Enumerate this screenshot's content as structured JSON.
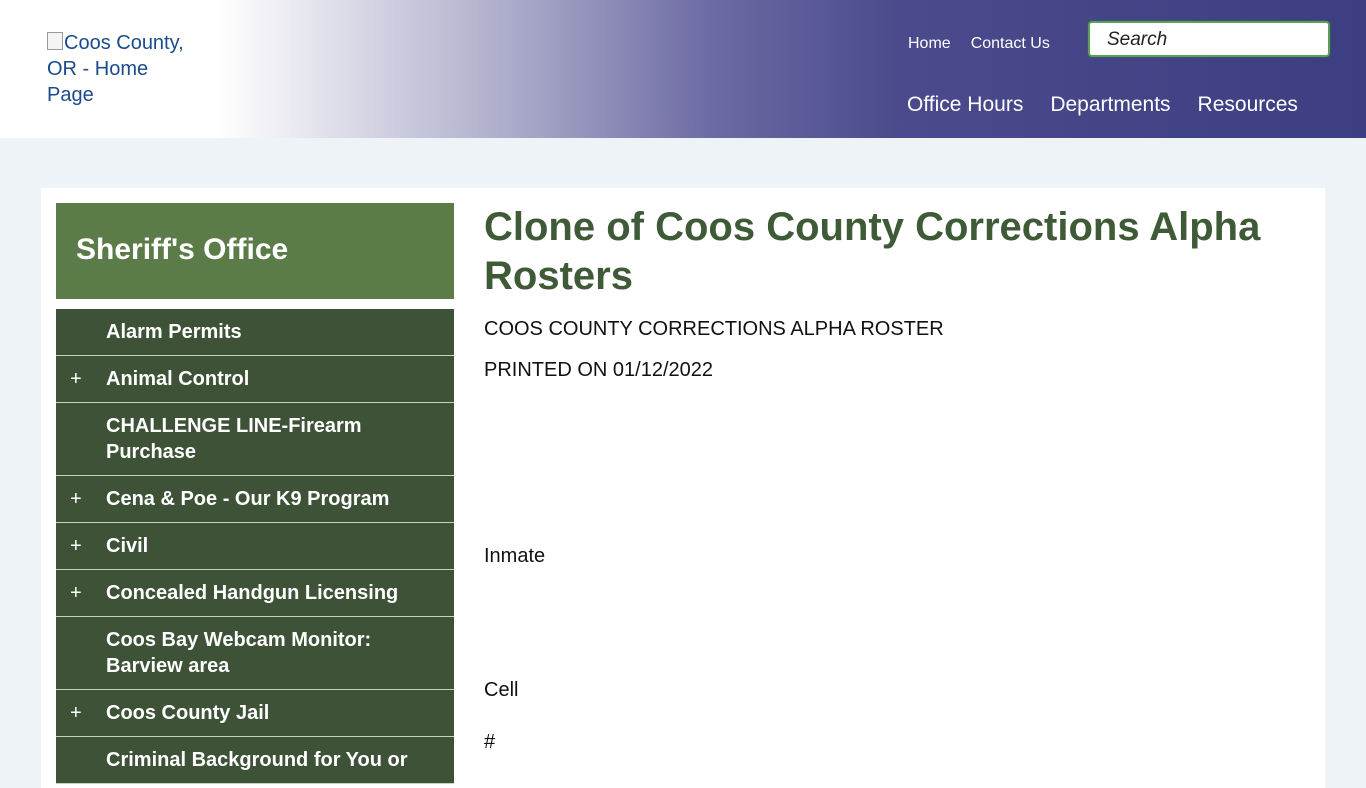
{
  "header": {
    "logo_alt": "Coos County, OR - Home Page",
    "top_links": [
      "Home",
      "Contact Us"
    ],
    "search_placeholder": "Search",
    "main_nav": [
      "Office Hours",
      "Departments",
      "Resources"
    ]
  },
  "sidebar": {
    "title": "Sheriff's Office",
    "items": [
      {
        "label": "Alarm Permits",
        "expandable": false
      },
      {
        "label": "Animal Control",
        "expandable": true
      },
      {
        "label": "CHALLENGE LINE-Firearm Purchase",
        "expandable": false
      },
      {
        "label": "Cena & Poe - Our K9 Program",
        "expandable": true
      },
      {
        "label": "Civil",
        "expandable": true
      },
      {
        "label": "Concealed Handgun Licensing",
        "expandable": true
      },
      {
        "label": "Coos Bay Webcam Monitor: Barview area",
        "expandable": false
      },
      {
        "label": "Coos County Jail",
        "expandable": true
      },
      {
        "label": "Criminal Background for You or",
        "expandable": false
      }
    ]
  },
  "main": {
    "title": "Clone of Coos County Corrections Alpha Rosters",
    "roster_heading": "COOS COUNTY CORRECTIONS ALPHA ROSTER",
    "printed_on": "PRINTED ON 01/12/2022",
    "col_inmate": "Inmate",
    "col_cell": "Cell",
    "col_number": "#"
  },
  "colors": {
    "sidebar_title_bg": "#5b7b48",
    "sidebar_item_bg": "#3d5237",
    "title_text": "#3e5a37",
    "header_dark": "#3d3d82"
  }
}
